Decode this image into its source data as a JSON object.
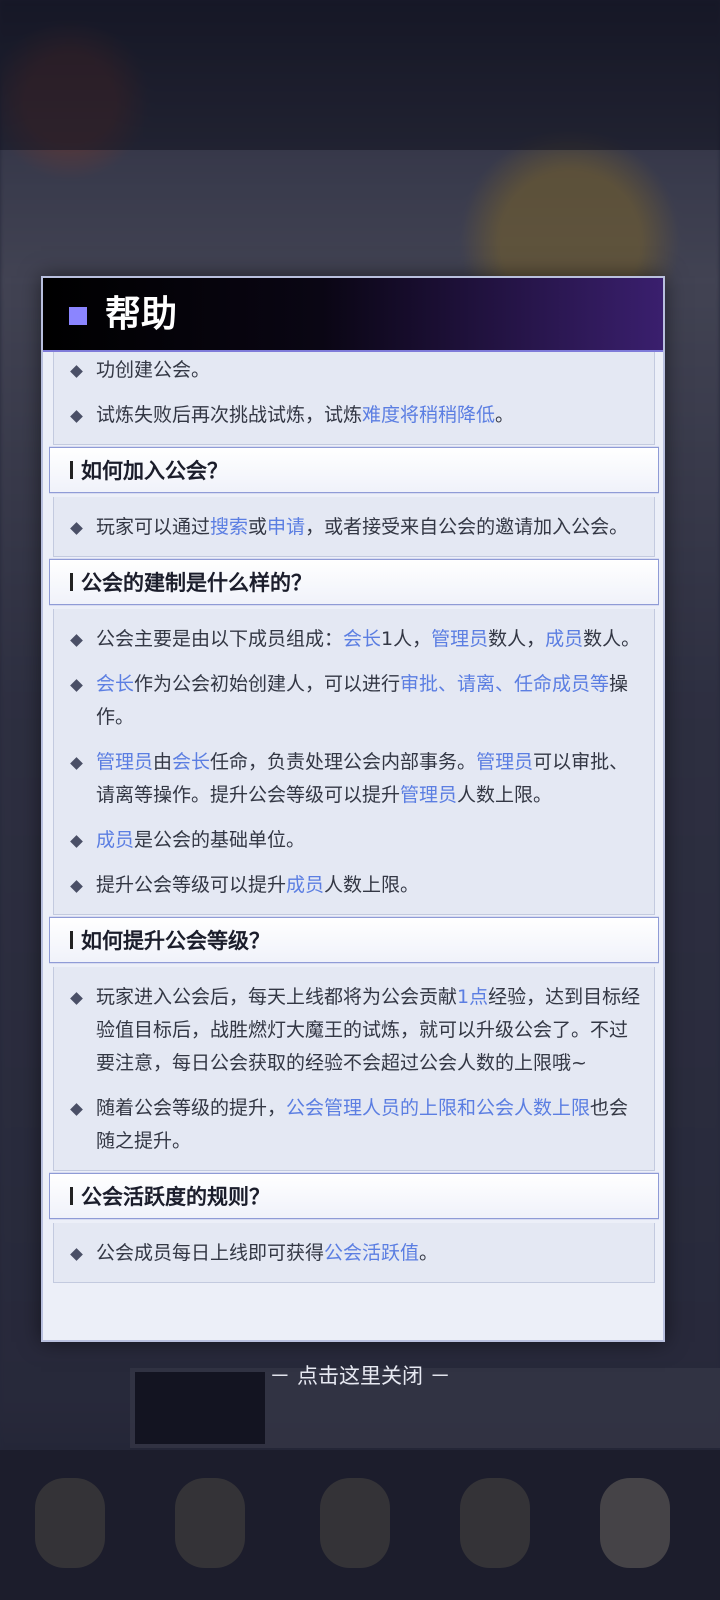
{
  "dialog": {
    "title": "帮助",
    "sections": [
      {
        "items": [
          {
            "parts": [
              {
                "t": "功创建公会。"
              }
            ]
          },
          {
            "parts": [
              {
                "t": "试炼失败后再次挑战试炼，试炼"
              },
              {
                "t": "难度将稍稍降低",
                "hl": true
              },
              {
                "t": "。"
              }
            ]
          }
        ]
      },
      {
        "header": "如何加入公会？",
        "items": [
          {
            "parts": [
              {
                "t": "玩家可以通过"
              },
              {
                "t": "搜索",
                "hl": true
              },
              {
                "t": "或"
              },
              {
                "t": "申请",
                "hl": true
              },
              {
                "t": "，或者接受来自公会的邀请加入公会。"
              }
            ]
          }
        ]
      },
      {
        "header": "公会的建制是什么样的？",
        "items": [
          {
            "parts": [
              {
                "t": "公会主要是由以下成员组成："
              },
              {
                "t": "会长",
                "hl": true
              },
              {
                "t": "1人，"
              },
              {
                "t": "管理员",
                "hl": true
              },
              {
                "t": "数人，"
              },
              {
                "t": "成员",
                "hl": true
              },
              {
                "t": "数人。"
              }
            ]
          },
          {
            "parts": [
              {
                "t": "会长",
                "hl": true
              },
              {
                "t": "作为公会初始创建人，可以进行"
              },
              {
                "t": "审批、请离、任命成员等",
                "hl": true
              },
              {
                "t": "操作。"
              }
            ]
          },
          {
            "parts": [
              {
                "t": "管理员",
                "hl": true
              },
              {
                "t": "由"
              },
              {
                "t": "会长",
                "hl": true
              },
              {
                "t": "任命，负责处理公会内部事务。"
              },
              {
                "t": "管理员",
                "hl": true
              },
              {
                "t": "可以审批、请离等操作。提升公会等级可以提升"
              },
              {
                "t": "管理员",
                "hl": true
              },
              {
                "t": "人数上限。"
              }
            ]
          },
          {
            "parts": [
              {
                "t": "成员",
                "hl": true
              },
              {
                "t": "是公会的基础单位。"
              }
            ]
          },
          {
            "parts": [
              {
                "t": "提升公会等级可以提升"
              },
              {
                "t": "成员",
                "hl": true
              },
              {
                "t": "人数上限。"
              }
            ]
          }
        ]
      },
      {
        "header": "如何提升公会等级？",
        "items": [
          {
            "parts": [
              {
                "t": "玩家进入公会后，每天上线都将为公会贡献"
              },
              {
                "t": "1点",
                "hl": true
              },
              {
                "t": "经验，达到目标经验值目标后，战胜燃灯大魔王的试炼，就可以升级公会了。不过要注意，每日公会获取的经验不会超过公会人数的上限哦~"
              }
            ]
          },
          {
            "parts": [
              {
                "t": "随着公会等级的提升，"
              },
              {
                "t": "公会管理人员的上限和公会人数上限",
                "hl": true
              },
              {
                "t": "也会随之提升。"
              }
            ]
          }
        ]
      },
      {
        "header": "公会活跃度的规则？",
        "items": [
          {
            "parts": [
              {
                "t": "公会成员每日上线即可获得"
              },
              {
                "t": "公会活跃值",
                "hl": true
              },
              {
                "t": "。"
              }
            ]
          }
        ]
      }
    ]
  },
  "close_hint": "－ 点击这里关闭 －",
  "colors": {
    "highlight": "#5b7ee2",
    "accent": "#8b85ff",
    "header_bg": "#000000"
  }
}
